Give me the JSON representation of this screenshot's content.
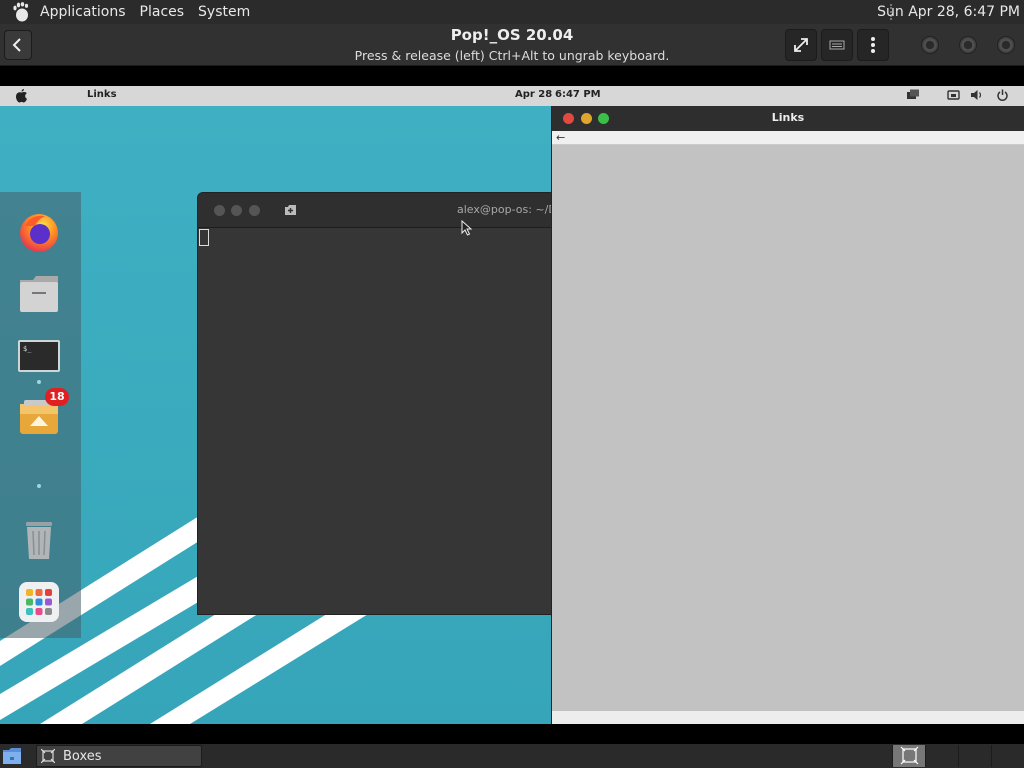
{
  "host_panel": {
    "applications": "Applications",
    "places": "Places",
    "system": "System",
    "clock": "Sun Apr 28,  6:47 PM"
  },
  "boxes_header": {
    "title": "Pop!_OS 20.04",
    "subtitle": "Press & release (left) Ctrl+Alt to ungrab keyboard."
  },
  "guest_panel": {
    "app_name": "Links",
    "date": "Apr 28",
    "time": "6:47 PM"
  },
  "dock": {
    "items": [
      "firefox-icon",
      "files-icon",
      "terminal-icon",
      "software-icon",
      "trash-icon",
      "app-grid-icon"
    ],
    "software_badge": "18"
  },
  "terminal": {
    "title": "alex@pop-os: ~/Do"
  },
  "links_window": {
    "title": "Links",
    "back_arrow": "←"
  },
  "taskbar": {
    "task_label": "Boxes"
  },
  "colors": {
    "wallpaper": "#3aabbe",
    "close": "#e3493f",
    "minimize": "#e0a52d",
    "maximize": "#3cbe4b",
    "badge": "#e02020"
  }
}
